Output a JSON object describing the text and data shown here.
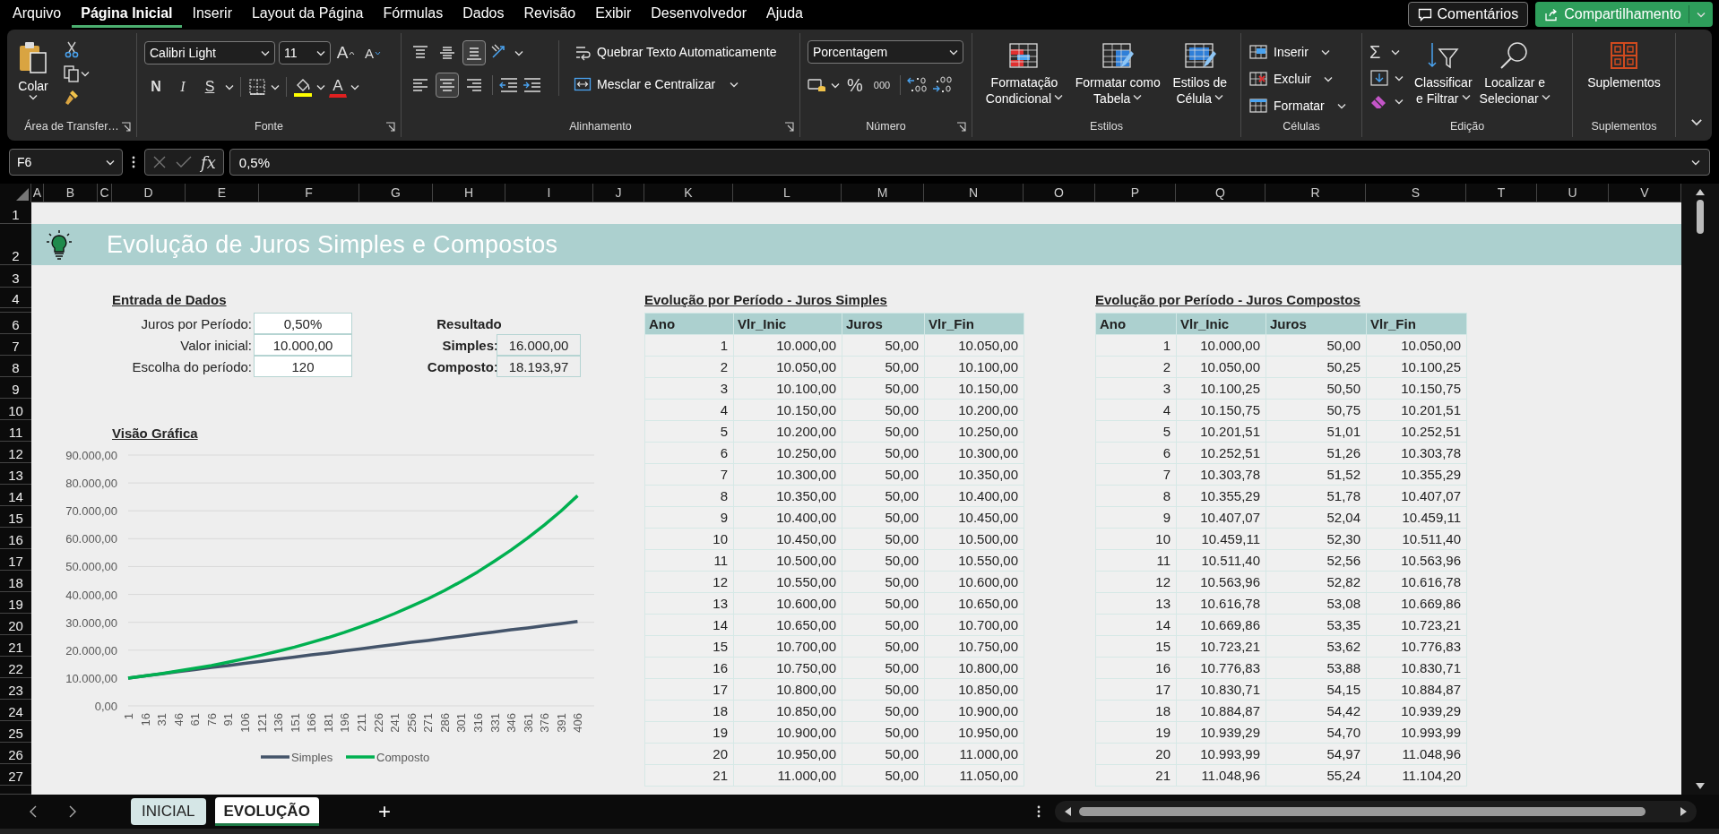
{
  "menu_tabs": [
    {
      "label": "Arquivo",
      "selected": false
    },
    {
      "label": "Página Inicial",
      "selected": true
    },
    {
      "label": "Inserir",
      "selected": false
    },
    {
      "label": "Layout da Página",
      "selected": false
    },
    {
      "label": "Fórmulas",
      "selected": false
    },
    {
      "label": "Dados",
      "selected": false
    },
    {
      "label": "Revisão",
      "selected": false
    },
    {
      "label": "Exibir",
      "selected": false
    },
    {
      "label": "Desenvolvedor",
      "selected": false
    },
    {
      "label": "Ajuda",
      "selected": false
    }
  ],
  "header_buttons": {
    "comments": "Comentários",
    "share": "Compartilhamento"
  },
  "ribbon": {
    "clipboard": {
      "paste": "Colar",
      "group": "Área de Transfer…"
    },
    "font": {
      "family": "Calibri Light",
      "size": "11",
      "grow": "A",
      "shrink": "A",
      "bold": "N",
      "italic": "I",
      "underline": "S",
      "font_color": "A",
      "group": "Fonte"
    },
    "alignment": {
      "vertical": [
        {
          "kind": "top",
          "selected": false
        },
        {
          "kind": "middle",
          "selected": false
        },
        {
          "kind": "bottom",
          "selected": true
        }
      ],
      "horizontal": [
        {
          "kind": "left",
          "selected": false
        },
        {
          "kind": "center",
          "selected": true
        },
        {
          "kind": "right",
          "selected": false
        }
      ],
      "wrap": "Quebrar Texto Automaticamente",
      "merge": "Mesclar e Centralizar",
      "group": "Alinhamento"
    },
    "number": {
      "format": "Porcentagem",
      "percent": "%",
      "thousands": "000",
      "group": "Número"
    },
    "styles": {
      "items": [
        {
          "kind": "conditional",
          "lines": [
            "Formatação",
            "Condicional"
          ]
        },
        {
          "kind": "table",
          "lines": [
            "Formatar como",
            "Tabela"
          ]
        },
        {
          "kind": "cell",
          "lines": [
            "Estilos de",
            "Célula"
          ]
        }
      ],
      "group": "Estilos"
    },
    "cells": {
      "items": [
        {
          "kind": "insert",
          "label": "Inserir"
        },
        {
          "kind": "delete",
          "label": "Excluir"
        },
        {
          "kind": "format",
          "label": "Formatar"
        }
      ],
      "group": "Células"
    },
    "editing": {
      "sum": "Σ",
      "sort": [
        "Classificar",
        "e Filtrar"
      ],
      "find": [
        "Localizar e",
        "Selecionar"
      ],
      "group": "Edição"
    },
    "addins": {
      "label": "Suplementos",
      "group": "Suplementos"
    }
  },
  "formula_bar": {
    "name_box": "F6",
    "fx": "fx",
    "value": "0,5%"
  },
  "columns": [
    "A",
    "B",
    "C",
    "D",
    "E",
    "F",
    "G",
    "H",
    "I",
    "J",
    "K",
    "L",
    "M",
    "N",
    "O",
    "P",
    "Q",
    "R",
    "S",
    "T",
    "U",
    "V"
  ],
  "rows": [
    "1",
    "2",
    "3",
    "4",
    "6",
    "7",
    "8",
    "9",
    "10",
    "11",
    "12",
    "13",
    "14",
    "15",
    "16",
    "17",
    "18",
    "19",
    "20",
    "21",
    "22",
    "23",
    "24",
    "25",
    "26",
    "27"
  ],
  "sheet": {
    "title": "Evolução de Juros Simples e Compostos",
    "inputs": {
      "heading": "Entrada de Dados",
      "items": [
        {
          "label": "Juros por Período:",
          "value": "0,50%"
        },
        {
          "label": "Valor inicial:",
          "value": "10.000,00"
        },
        {
          "label": "Escolha do período:",
          "value": "120"
        }
      ]
    },
    "results": {
      "heading": "Resultado",
      "items": [
        {
          "label": "Simples:",
          "value": "16.000,00"
        },
        {
          "label": "Composto:",
          "value": "18.193,97"
        }
      ]
    },
    "chart_heading": "Visão Gráfica",
    "chart_data": {
      "type": "line",
      "categories": [
        "1",
        "16",
        "31",
        "46",
        "61",
        "76",
        "91",
        "106",
        "121",
        "136",
        "151",
        "166",
        "181",
        "196",
        "211",
        "226",
        "241",
        "256",
        "271",
        "286",
        "301",
        "316",
        "331",
        "346",
        "361",
        "376",
        "391",
        "406"
      ],
      "series": [
        {
          "name": "Simples",
          "color": "#44546a",
          "values": [
            10000,
            10800,
            11500,
            12300,
            13000,
            13800,
            14500,
            15300,
            16000,
            16800,
            17500,
            18300,
            19000,
            19800,
            20500,
            21300,
            22000,
            22800,
            23500,
            24300,
            25000,
            25800,
            26500,
            27300,
            28000,
            28800,
            29500,
            30300
          ]
        },
        {
          "name": "Composto",
          "color": "#00b050",
          "values": [
            10000,
            10800,
            11600,
            12500,
            13500,
            14500,
            15700,
            16900,
            18200,
            19600,
            21100,
            22800,
            24500,
            26400,
            28500,
            30700,
            33100,
            35700,
            38400,
            41400,
            44600,
            48100,
            51900,
            55900,
            60200,
            64900,
            69900,
            75400
          ]
        }
      ],
      "ylim": [
        0,
        90000
      ],
      "grid": true,
      "legend": true,
      "yticks": [
        {
          "value": 0,
          "label": "0,00"
        },
        {
          "value": 10000,
          "label": "10.000,00"
        },
        {
          "value": 20000,
          "label": "20.000,00"
        },
        {
          "value": 30000,
          "label": "30.000,00"
        },
        {
          "value": 40000,
          "label": "40.000,00"
        },
        {
          "value": 50000,
          "label": "50.000,00"
        },
        {
          "value": 60000,
          "label": "60.000,00"
        },
        {
          "value": 70000,
          "label": "70.000,00"
        },
        {
          "value": 80000,
          "label": "80.000,00"
        },
        {
          "value": 90000,
          "label": "90.000,00"
        }
      ]
    },
    "simple_table": {
      "heading": "Evolução por Período - Juros Simples",
      "columns": [
        "Ano",
        "Vlr_Inic",
        "Juros",
        "Vlr_Fin"
      ],
      "rows": [
        [
          "1",
          "10.000,00",
          "50,00",
          "10.050,00"
        ],
        [
          "2",
          "10.050,00",
          "50,00",
          "10.100,00"
        ],
        [
          "3",
          "10.100,00",
          "50,00",
          "10.150,00"
        ],
        [
          "4",
          "10.150,00",
          "50,00",
          "10.200,00"
        ],
        [
          "5",
          "10.200,00",
          "50,00",
          "10.250,00"
        ],
        [
          "6",
          "10.250,00",
          "50,00",
          "10.300,00"
        ],
        [
          "7",
          "10.300,00",
          "50,00",
          "10.350,00"
        ],
        [
          "8",
          "10.350,00",
          "50,00",
          "10.400,00"
        ],
        [
          "9",
          "10.400,00",
          "50,00",
          "10.450,00"
        ],
        [
          "10",
          "10.450,00",
          "50,00",
          "10.500,00"
        ],
        [
          "11",
          "10.500,00",
          "50,00",
          "10.550,00"
        ],
        [
          "12",
          "10.550,00",
          "50,00",
          "10.600,00"
        ],
        [
          "13",
          "10.600,00",
          "50,00",
          "10.650,00"
        ],
        [
          "14",
          "10.650,00",
          "50,00",
          "10.700,00"
        ],
        [
          "15",
          "10.700,00",
          "50,00",
          "10.750,00"
        ],
        [
          "16",
          "10.750,00",
          "50,00",
          "10.800,00"
        ],
        [
          "17",
          "10.800,00",
          "50,00",
          "10.850,00"
        ],
        [
          "18",
          "10.850,00",
          "50,00",
          "10.900,00"
        ],
        [
          "19",
          "10.900,00",
          "50,00",
          "10.950,00"
        ],
        [
          "20",
          "10.950,00",
          "50,00",
          "11.000,00"
        ],
        [
          "21",
          "11.000,00",
          "50,00",
          "11.050,00"
        ]
      ]
    },
    "compound_table": {
      "heading": "Evolução por Período - Juros Compostos",
      "columns": [
        "Ano",
        "Vlr_Inic",
        "Juros",
        "Vlr_Fin"
      ],
      "rows": [
        [
          "1",
          "10.000,00",
          "50,00",
          "10.050,00"
        ],
        [
          "2",
          "10.050,00",
          "50,25",
          "10.100,25"
        ],
        [
          "3",
          "10.100,25",
          "50,50",
          "10.150,75"
        ],
        [
          "4",
          "10.150,75",
          "50,75",
          "10.201,51"
        ],
        [
          "5",
          "10.201,51",
          "51,01",
          "10.252,51"
        ],
        [
          "6",
          "10.252,51",
          "51,26",
          "10.303,78"
        ],
        [
          "7",
          "10.303,78",
          "51,52",
          "10.355,29"
        ],
        [
          "8",
          "10.355,29",
          "51,78",
          "10.407,07"
        ],
        [
          "9",
          "10.407,07",
          "52,04",
          "10.459,11"
        ],
        [
          "10",
          "10.459,11",
          "52,30",
          "10.511,40"
        ],
        [
          "11",
          "10.511,40",
          "52,56",
          "10.563,96"
        ],
        [
          "12",
          "10.563,96",
          "52,82",
          "10.616,78"
        ],
        [
          "13",
          "10.616,78",
          "53,08",
          "10.669,86"
        ],
        [
          "14",
          "10.669,86",
          "53,35",
          "10.723,21"
        ],
        [
          "15",
          "10.723,21",
          "53,62",
          "10.776,83"
        ],
        [
          "16",
          "10.776,83",
          "53,88",
          "10.830,71"
        ],
        [
          "17",
          "10.830,71",
          "54,15",
          "10.884,87"
        ],
        [
          "18",
          "10.884,87",
          "54,42",
          "10.939,29"
        ],
        [
          "19",
          "10.939,29",
          "54,70",
          "10.993,99"
        ],
        [
          "20",
          "10.993,99",
          "54,97",
          "11.048,96"
        ],
        [
          "21",
          "11.048,96",
          "55,24",
          "11.104,20"
        ]
      ]
    }
  },
  "sheet_tabs": [
    {
      "label": "INICIAL",
      "selected": false
    },
    {
      "label": "EVOLUÇÃO",
      "selected": true
    }
  ],
  "add_sheet": "+"
}
